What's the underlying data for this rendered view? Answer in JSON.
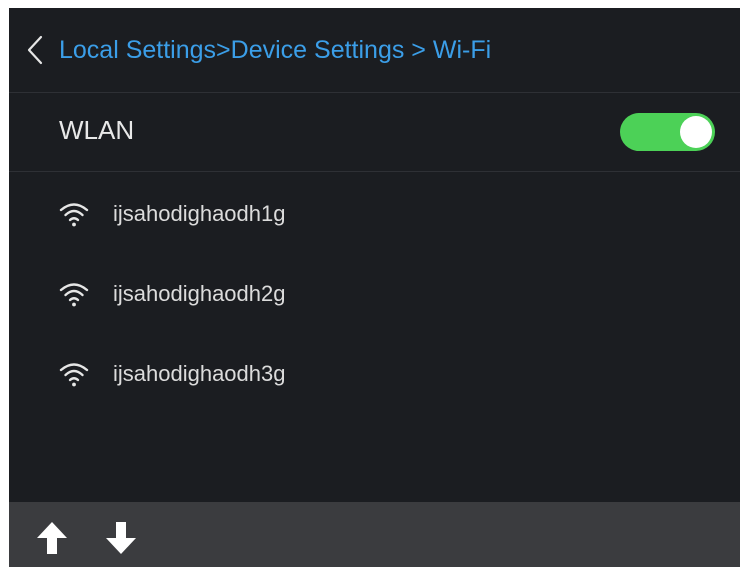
{
  "header": {
    "back_icon": "chevron-left-icon",
    "breadcrumb": [
      {
        "label": "Local Settings"
      },
      {
        "separator": ">"
      },
      {
        "label": "Device Settings"
      },
      {
        "separator": " > "
      },
      {
        "label": "Wi-Fi"
      }
    ]
  },
  "wlan": {
    "label": "WLAN",
    "enabled": true,
    "toggle_color": "#4cd157"
  },
  "networks": [
    {
      "ssid": "ijsahodighaodh1g",
      "icon": "wifi-icon"
    },
    {
      "ssid": "ijsahodighaodh2g",
      "icon": "wifi-icon"
    },
    {
      "ssid": "ijsahodighaodh3g",
      "icon": "wifi-icon"
    }
  ],
  "footer": {
    "up_icon": "arrow-up-icon",
    "down_icon": "arrow-down-icon"
  },
  "colors": {
    "background": "#1b1d21",
    "accent": "#3b9ee8",
    "footer": "#3b3c3f"
  }
}
